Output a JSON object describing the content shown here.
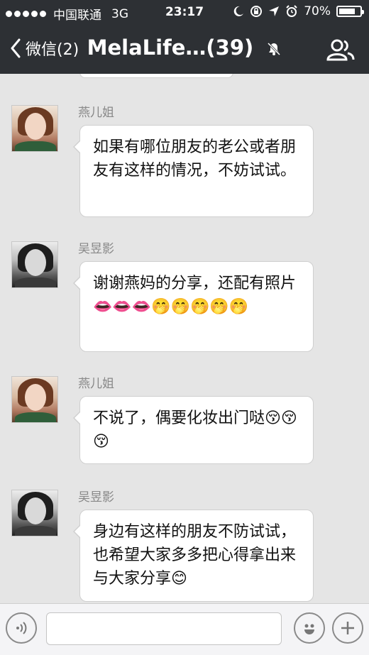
{
  "status_bar": {
    "carrier": "中国联通",
    "network": "3G",
    "time": "23:17",
    "battery": "70%"
  },
  "nav": {
    "back_label": "微信(2)",
    "title": "MelaLife…(39)"
  },
  "messages": [
    {
      "sender": "燕儿姐",
      "text": "如果有哪位朋友的老公或者朋友有这样的情况，不妨试试。"
    },
    {
      "sender": "吴昱影",
      "text": "谢谢燕妈的分享，还配有照片👄👄👄🤭🤭🤭🤭🤭"
    },
    {
      "sender": "燕儿姐",
      "text": "不说了，偶要化妆出门哒😚😚😚"
    },
    {
      "sender": "吴昱影",
      "text": "身边有这样的朋友不防试试，也希望大家多多把心得拿出来与大家分享😊"
    }
  ],
  "input_bar": {
    "placeholder": ""
  },
  "colors": {
    "nav_bg": "#2d3034",
    "chat_bg": "#e5e5e5",
    "bubble_bg": "#ffffff"
  }
}
